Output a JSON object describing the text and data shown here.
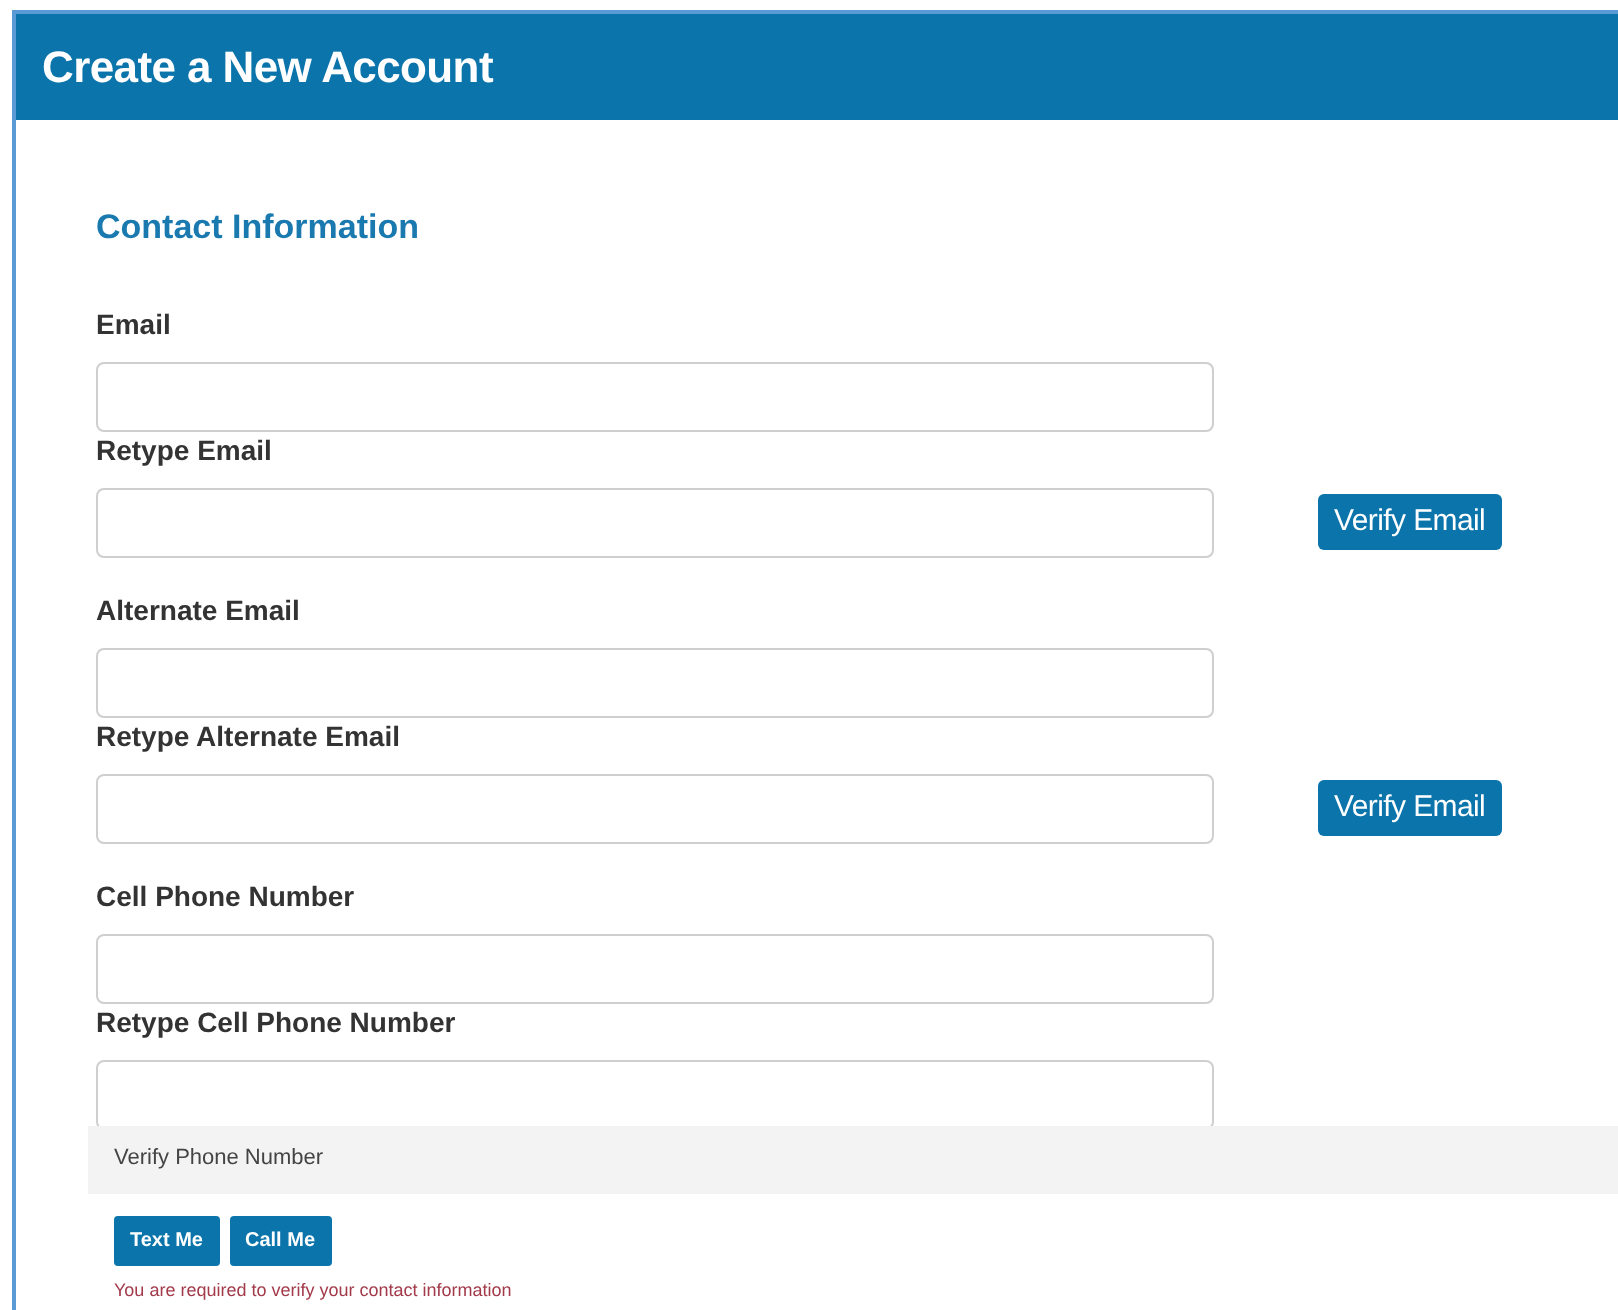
{
  "header": {
    "title": "Create a New Account"
  },
  "section": {
    "title": "Contact Information"
  },
  "groups": [
    {
      "fields": [
        {
          "label": "Email"
        },
        {
          "label": "Retype Email"
        }
      ],
      "button": "Verify Email"
    },
    {
      "fields": [
        {
          "label": "Alternate Email"
        },
        {
          "label": "Retype Alternate Email"
        }
      ],
      "button": "Verify Email"
    },
    {
      "fields": [
        {
          "label": "Cell Phone Number"
        },
        {
          "label": "Retype Cell Phone Number"
        }
      ]
    }
  ],
  "verify_panel": {
    "title": "Verify Phone Number",
    "buttons": [
      "Text Me",
      "Call Me"
    ],
    "error": "You are required to verify your contact information"
  }
}
